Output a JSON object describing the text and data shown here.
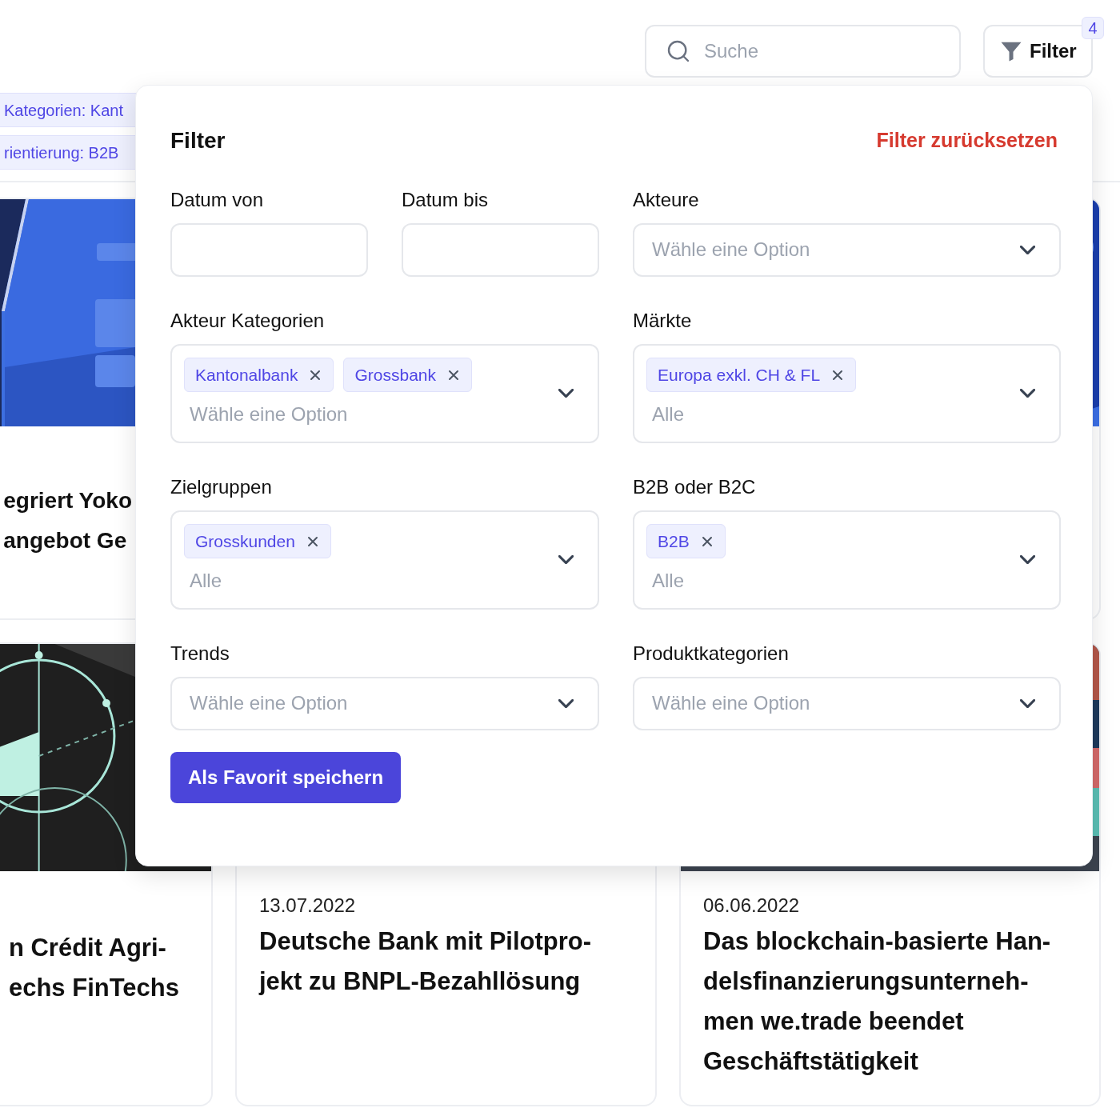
{
  "search": {
    "placeholder": "Suche"
  },
  "filter_button": {
    "label": "Filter",
    "badge": "4"
  },
  "active_filters": [
    {
      "label": "Kategorien: Kant"
    },
    {
      "label": "rientierung: B2B"
    }
  ],
  "top_cards": [
    {
      "image": {
        "kind": "picture"
      },
      "title_lines": [
        "egriert Yoko",
        "angebot Ge"
      ]
    },
    {
      "image": {
        "kind": "picture"
      }
    }
  ],
  "bottom_cards": [
    {
      "image": {
        "kind": "picture"
      },
      "title_lines": [
        "n Crédit Agri-",
        "echs FinTechs"
      ]
    },
    {
      "date": "13.07.2022",
      "title_lines": [
        "Deutsche Bank mit Pilotpro-",
        "jekt zu BNPL-Bezahllösung"
      ]
    },
    {
      "image": {
        "kind": "picture"
      },
      "date": "06.06.2022",
      "title_lines": [
        "Das blockchain-basierte Han-",
        "delsfinanzierungsunterneh-",
        "men we.trade beendet",
        "Geschäftstätigkeit"
      ]
    }
  ],
  "filter_panel": {
    "title": "Filter",
    "reset": "Filter zurücksetzen",
    "fields": [
      {
        "kind": "date",
        "label": "Datum von"
      },
      {
        "kind": "date",
        "label": "Datum bis"
      },
      {
        "kind": "select",
        "label": "Akteure",
        "placeholder": "Wähle eine Option"
      },
      {
        "kind": "multi",
        "label": "Akteur Kategorien",
        "tags": [
          "Kantonalbank",
          "Grossbank"
        ],
        "placeholder": "Wähle eine Option"
      },
      {
        "kind": "multi",
        "label": "Märkte",
        "tags": [
          "Europa exkl. CH & FL"
        ],
        "placeholder": "Alle"
      },
      {
        "kind": "multi",
        "label": "Zielgruppen",
        "tags": [
          "Grosskunden"
        ],
        "placeholder": "Alle"
      },
      {
        "kind": "multi",
        "label": "B2B oder B2C",
        "tags": [
          "B2B"
        ],
        "placeholder": "Alle"
      },
      {
        "kind": "select",
        "label": "Trends",
        "placeholder": "Wähle eine Option"
      },
      {
        "kind": "select",
        "label": "Produktkategorien",
        "placeholder": "Wähle eine Option"
      }
    ],
    "save_button": "Als Favorit speichern"
  }
}
